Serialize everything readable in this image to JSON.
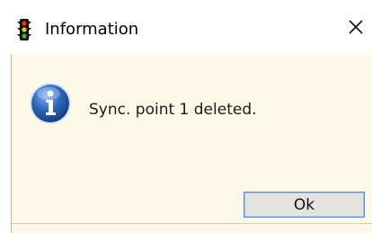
{
  "window": {
    "title": "Information",
    "title_icon": "traffic-light-icon",
    "close_icon": "close-icon"
  },
  "content": {
    "message_icon": "info-icon",
    "message": "Sync. point 1 deleted."
  },
  "buttons": {
    "ok_label": "Ok"
  },
  "colors": {
    "body_background": "#fdf8e8",
    "info_blue": "#2c66b8",
    "button_border": "#5a8fd0"
  }
}
